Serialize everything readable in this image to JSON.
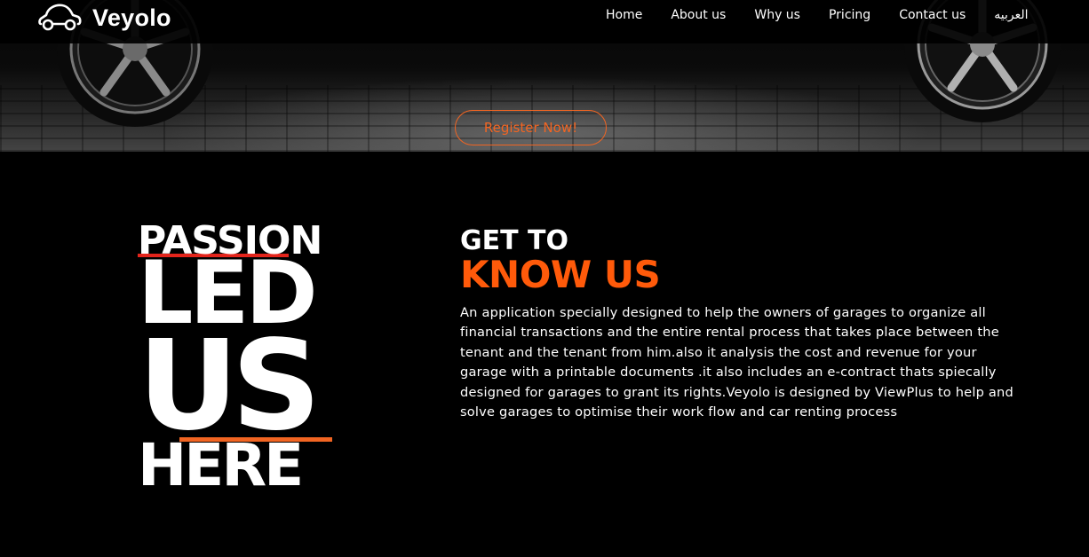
{
  "brand": {
    "name": "Veyolo",
    "logo_icon": "car-outline-icon"
  },
  "nav": {
    "items": [
      "Home",
      "About us",
      "Why us",
      "Pricing",
      "Contact us",
      "العربيه"
    ]
  },
  "hero": {
    "cta_label": "Register Now!"
  },
  "passion": {
    "words": [
      "PASSION",
      "LED",
      "US",
      "HERE"
    ],
    "accent_colors": {
      "red": "#e3241b",
      "orange": "#f26522"
    }
  },
  "about": {
    "kicker": "GET TO",
    "title": "KNOW US",
    "body": "An application specially designed to help the owners of garages to organize all financial transactions and the entire rental process that takes place between the tenant and the tenant from him.also it analysis the cost and revenue for your garage with a printable documents .it also includes an e-contract thats spiecally designed for garages to grant its rights.Veyolo is designed by ViewPlus to help and solve garages to optimise their work flow and car renting process"
  },
  "colors": {
    "accent": "#ff5a0a",
    "background": "#000000",
    "text": "#ffffff"
  }
}
